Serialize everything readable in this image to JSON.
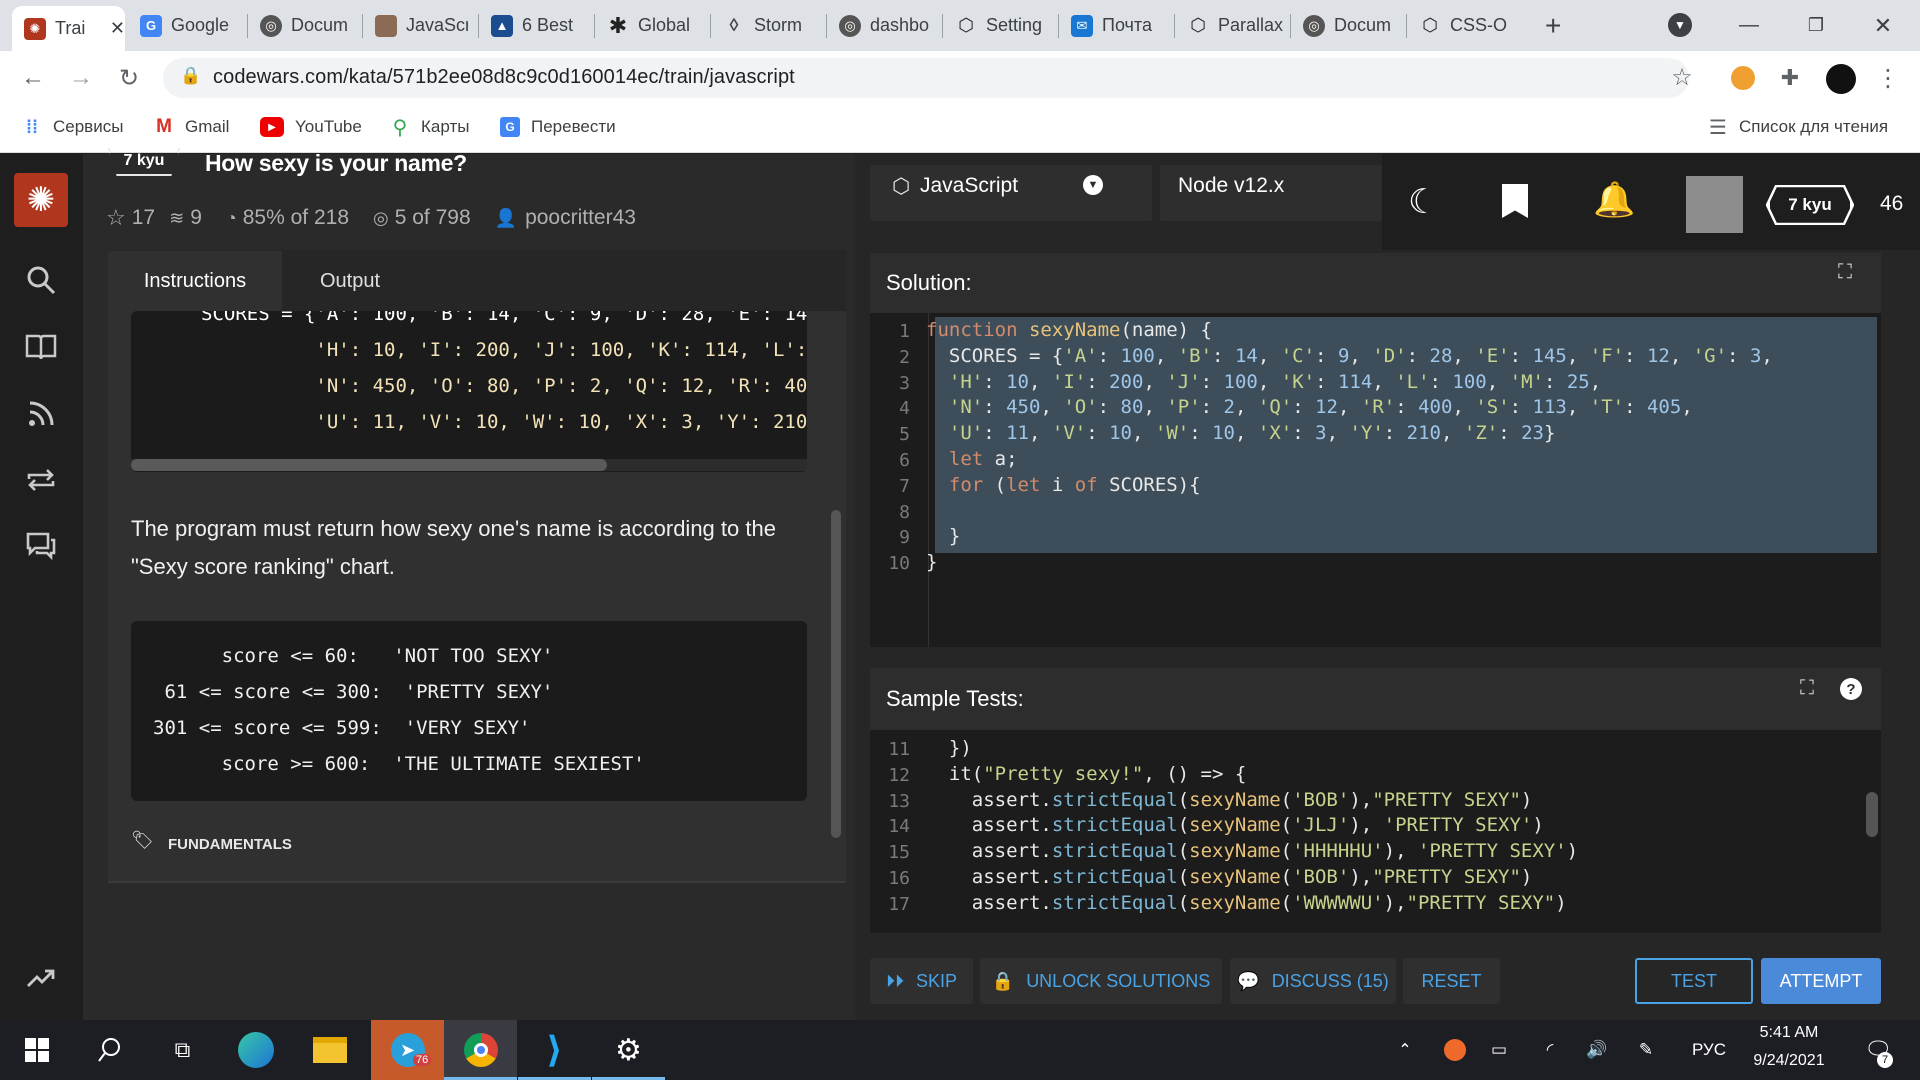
{
  "browser": {
    "tabs": [
      {
        "title": "Trai",
        "active": true
      },
      {
        "title": "Google"
      },
      {
        "title": "Docum"
      },
      {
        "title": "JavaScr"
      },
      {
        "title": "6 Best"
      },
      {
        "title": "Global"
      },
      {
        "title": "Storm"
      },
      {
        "title": "dashbo"
      },
      {
        "title": "Setting"
      },
      {
        "title": "Почта"
      },
      {
        "title": "Parallax"
      },
      {
        "title": "Docum"
      },
      {
        "title": "CSS-O"
      }
    ],
    "url": "codewars.com/kata/571b2ee08d8c9c0d160014ec/train/javascript",
    "bookmarks": [
      "Сервисы",
      "Gmail",
      "YouTube",
      "Карты",
      "Перевести"
    ],
    "reading_list": "Список для чтения"
  },
  "kata": {
    "rank": "7 kyu",
    "title": "How sexy is your name?",
    "stars": "17",
    "collections": "9",
    "satisfaction": "85% of 218",
    "completed": "5 of 798",
    "author": "poocritter43"
  },
  "instructions": {
    "tab_instructions": "Instructions",
    "tab_output": "Output",
    "code_lines": [
      "SCORES = {'A': 100, 'B': 14, 'C': 9, 'D': 28, 'E': 14",
      "          'H': 10, 'I': 200, 'J': 100, 'K': 114, 'L':",
      "          'N': 450, 'O': 80, 'P': 2, 'Q': 12, 'R': 40",
      "          'U': 11, 'V': 10, 'W': 10, 'X': 3, 'Y': 210"
    ],
    "paragraph": "The program must return how sexy one's name is according to the \"Sexy score ranking\" chart.",
    "ranking_lines": [
      "      score <= 60:   'NOT TOO SEXY'",
      " 61 <= score <= 300:  'PRETTY SEXY'",
      "301 <= score <= 599:  'VERY SEXY'",
      "      score >= 600:  'THE ULTIMATE SEXIEST'"
    ],
    "tag": "FUNDAMENTALS"
  },
  "editor": {
    "language": "JavaScript",
    "version": "Node v12.x",
    "solution_label": "Solution:",
    "solution_lines": [
      "function sexyName(name) {",
      "  SCORES = {'A': 100, 'B': 14, 'C': 9, 'D': 28, 'E': 145, 'F': 12, 'G': 3,",
      "  'H': 10, 'I': 200, 'J': 100, 'K': 114, 'L': 100, 'M': 25,",
      "  'N': 450, 'O': 80, 'P': 2, 'Q': 12, 'R': 400, 'S': 113, 'T': 405,",
      "  'U': 11, 'V': 10, 'W': 10, 'X': 3, 'Y': 210, 'Z': 23}",
      "  let a;",
      "  for (let i of SCORES){",
      "",
      "  }",
      "}"
    ],
    "solution_line_numbers": [
      "1",
      "2",
      "3",
      "4",
      "5",
      "6",
      "7",
      "8",
      "9",
      "10"
    ],
    "tests_label": "Sample Tests:",
    "test_line_numbers": [
      "11",
      "12",
      "13",
      "14",
      "15",
      "16",
      "17"
    ],
    "test_lines": [
      "  })",
      "  it(\"Pretty sexy!\", () => {",
      "    assert.strictEqual(sexyName('BOB'),\"PRETTY SEXY\")",
      "    assert.strictEqual(sexyName('JLJ'), 'PRETTY SEXY')",
      "    assert.strictEqual(sexyName('HHHHHU'), 'PRETTY SEXY')",
      "    assert.strictEqual(sexyName('BOB'),\"PRETTY SEXY\")",
      "    assert.strictEqual(sexyName('WWWWWU'),\"PRETTY SEXY\")"
    ]
  },
  "user": {
    "rank": "7 kyu",
    "honor": "46"
  },
  "actions": {
    "skip": "SKIP",
    "unlock": "UNLOCK SOLUTIONS",
    "discuss": "DISCUSS (15)",
    "reset": "RESET",
    "test": "TEST",
    "attempt": "ATTEMPT"
  },
  "taskbar": {
    "telegram_badge": "76",
    "lang": "РУС",
    "time": "5:41 AM",
    "date": "9/24/2021",
    "notifications": "7"
  },
  "colors": {
    "accent": "#b1361e",
    "button_blue": "#4aa3e6",
    "attempt_bg": "#4a8ad8"
  }
}
